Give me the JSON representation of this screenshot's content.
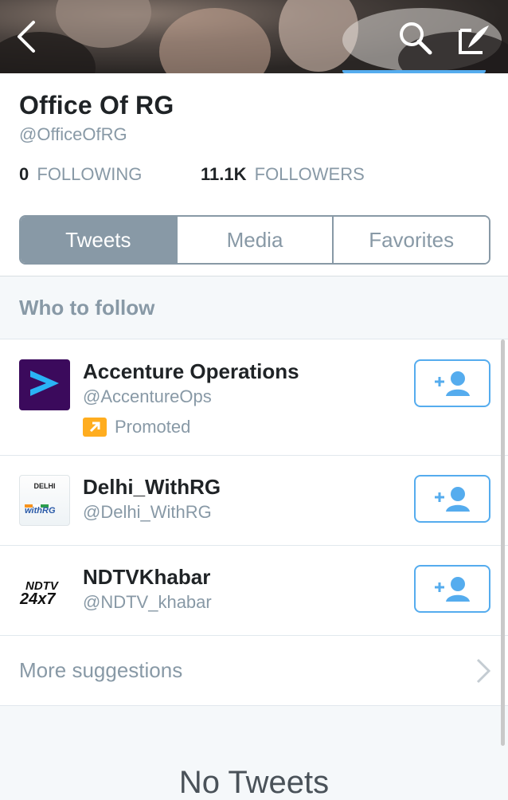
{
  "header": {
    "back_icon": "chevron-left-icon",
    "search_icon": "search-icon",
    "compose_icon": "compose-icon"
  },
  "profile": {
    "name": "Office Of RG",
    "handle": "@OfficeOfRG",
    "following_count": "0",
    "following_label": "FOLLOWING",
    "followers_count": "11.1K",
    "followers_label": "FOLLOWERS"
  },
  "tabs": [
    {
      "label": "Tweets",
      "selected": true
    },
    {
      "label": "Media",
      "selected": false
    },
    {
      "label": "Favorites",
      "selected": false
    }
  ],
  "who_to_follow": {
    "title": "Who to follow",
    "suggestions": [
      {
        "name": "Accenture Operations",
        "handle": "@AccentureOps",
        "promoted_label": "Promoted"
      },
      {
        "name": "Delhi_WithRG",
        "handle": "@Delhi_WithRG",
        "avatar_text_top": "DELHI",
        "avatar_text_bottom": "withRG"
      },
      {
        "name": "NDTVKhabar",
        "handle": "@NDTV_khabar",
        "avatar_text_top": "NDTV",
        "avatar_text_bottom": "24x7"
      }
    ],
    "more_label": "More suggestions"
  },
  "empty_state": "No Tweets",
  "colors": {
    "accent": "#55acee",
    "muted": "#8899a6",
    "promoted": "#ffad1f",
    "accenture_purple": "#3b0a5c"
  }
}
